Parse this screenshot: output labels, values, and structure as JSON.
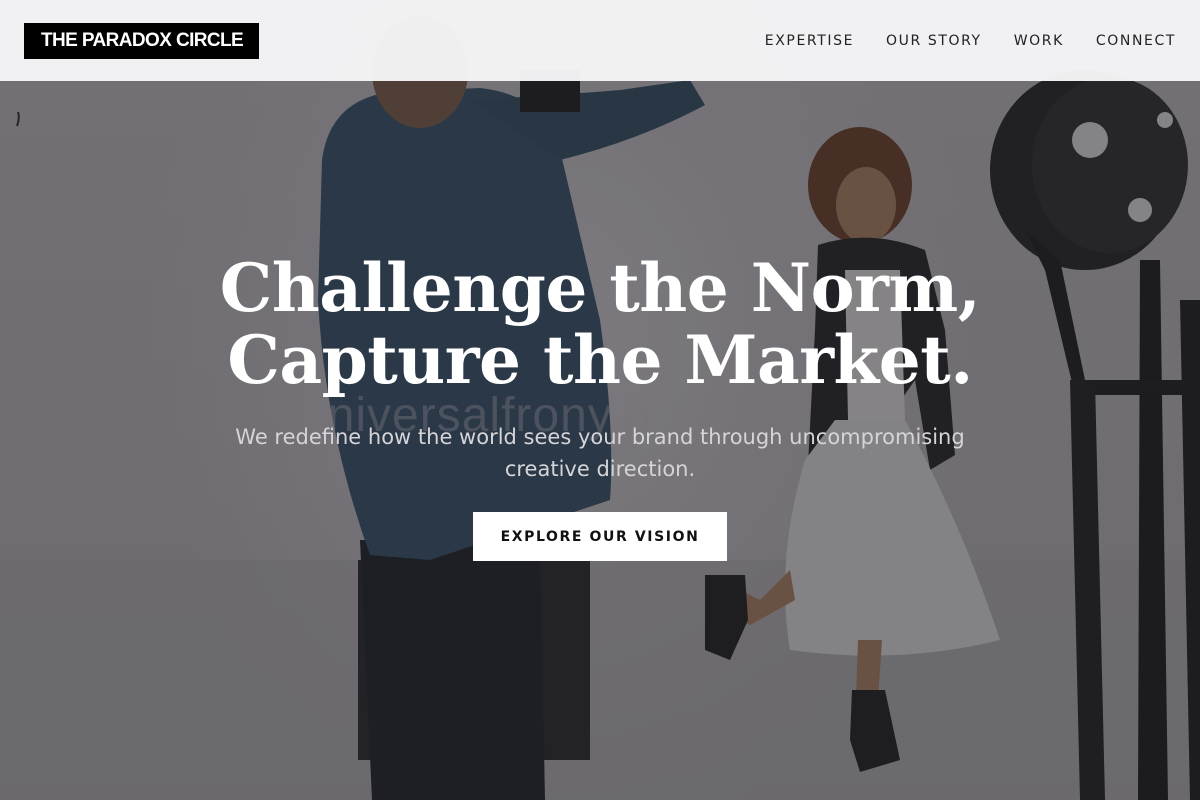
{
  "brand": {
    "name": "THE PARADOX CIRCLE"
  },
  "nav": {
    "items": [
      "EXPERTISE",
      "OUR STORY",
      "WORK",
      "CONNECT"
    ]
  },
  "hero": {
    "headline_line1": "Challenge the Norm,",
    "headline_line2": "Capture the Market.",
    "subtext": "We redefine how the world sees your brand through uncompromising creative direction.",
    "cta_label": "EXPLORE OUR VISION",
    "watermark": "universalfrony.biz"
  },
  "colors": {
    "header_bg": "#f5f5f6",
    "logo_bg": "#000000",
    "logo_text": "#ffffff",
    "headline": "#ffffff",
    "cta_bg": "#ffffff",
    "cta_text": "#111111"
  }
}
